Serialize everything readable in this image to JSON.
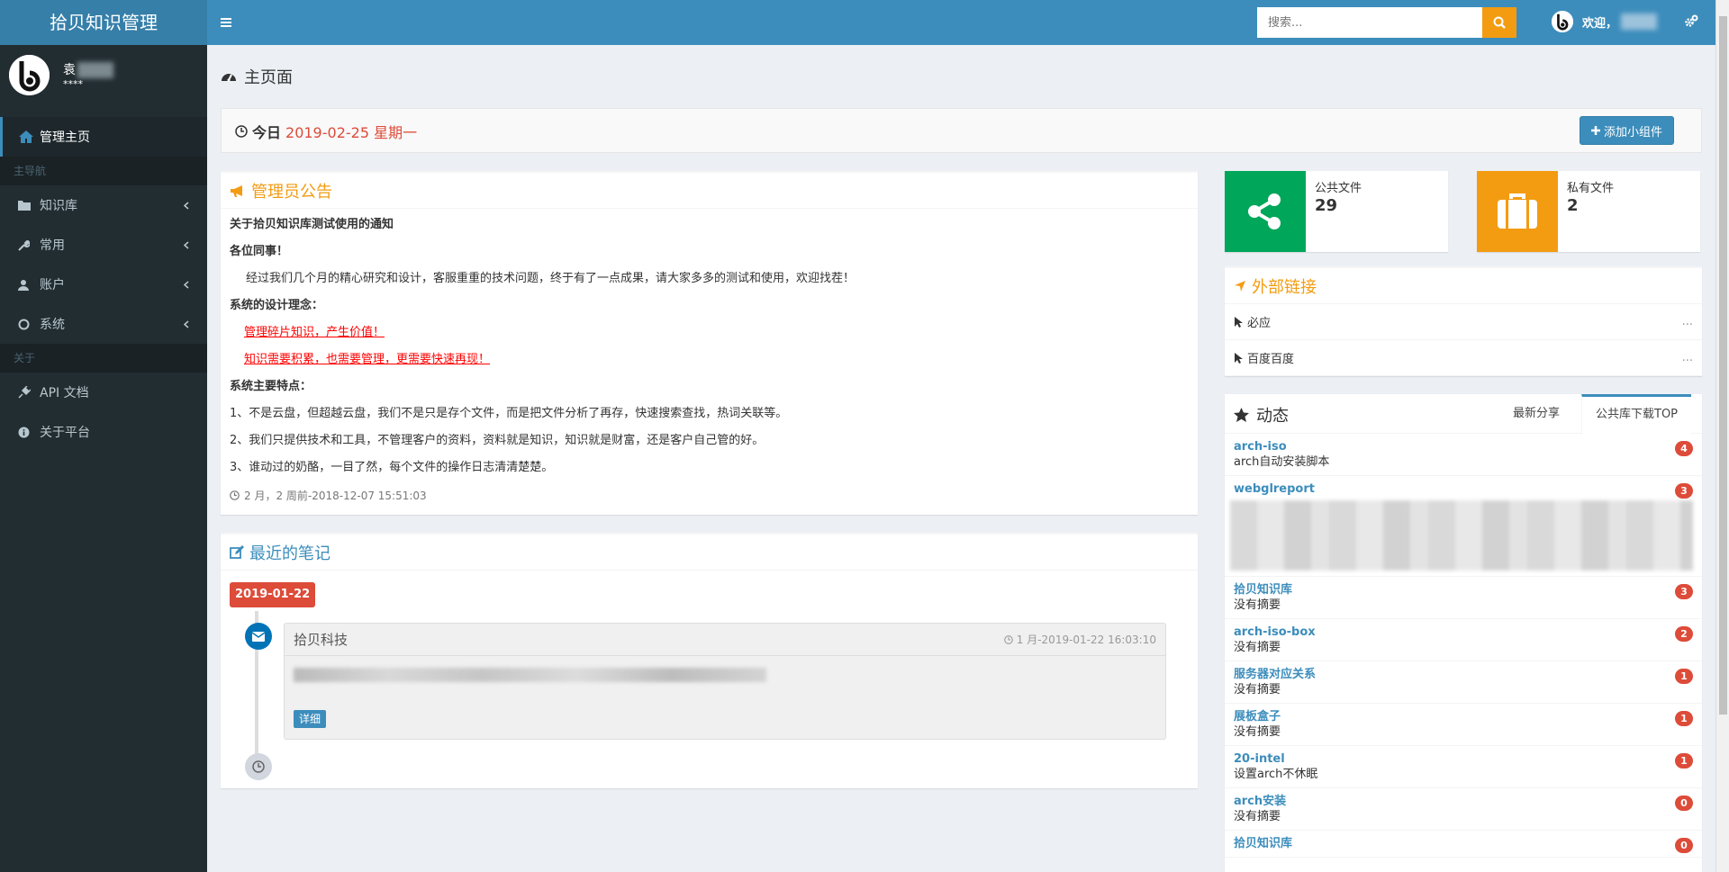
{
  "app": {
    "title": "拾贝知识管理"
  },
  "user": {
    "name": "袁",
    "status": "****",
    "welcome": "欢迎，"
  },
  "search": {
    "placeholder": "搜索..."
  },
  "sidebar": {
    "items": [
      {
        "label": "管理主页",
        "icon": "home-icon"
      },
      {
        "header": "主导航"
      },
      {
        "label": "知识库",
        "icon": "folder-icon"
      },
      {
        "label": "常用",
        "icon": "wrench-icon"
      },
      {
        "label": "账户",
        "icon": "user-icon"
      },
      {
        "label": "系统",
        "icon": "circle-icon"
      },
      {
        "header": "关于"
      },
      {
        "label": "API 文档",
        "icon": "plug-icon"
      },
      {
        "label": "关于平台",
        "icon": "info-icon"
      }
    ]
  },
  "page": {
    "title": "主页面"
  },
  "today": {
    "label": "今日",
    "date": "2019-02-25 星期一",
    "add_button": "添加小组件"
  },
  "notice": {
    "title": "管理员公告",
    "heading": "关于拾贝知识库测试使用的通知",
    "greeting": "各位同事！",
    "intro": "经过我们几个月的精心研究和设计，客服重重的技术问题，终于有了一点成果，请大家多多的测试和使用，欢迎找茬！",
    "concept_title": "系统的设计理念：",
    "concept_1": "管理碎片知识，产生价值！",
    "concept_2": "知识需要积累，也需要管理，更需要快速再现！",
    "features_title": "系统主要特点：",
    "feature_1": "1、不是云盘，但超越云盘，我们不是只是存个文件，而是把文件分析了再存，快速搜索查找，热词关联等。",
    "feature_2": "2、我们只提供技术和工具，不管理客户的资料，资料就是知识，知识就是财富，还是客户自己管的好。",
    "feature_3": "3、谁动过的奶酪，一目了然，每个文件的操作日志清清楚楚。",
    "meta": "2 月，2 周前-2018-12-07 15:51:03"
  },
  "notes": {
    "title": "最近的笔记",
    "date": "2019-01-22",
    "item_title": "拾贝科技",
    "item_time": "1 月-2019-01-22 16:03:10",
    "detail_button": "详细"
  },
  "stats": [
    {
      "label": "公共文件",
      "value": "29",
      "color": "#00a65a",
      "icon": "share-icon"
    },
    {
      "label": "私有文件",
      "value": "2",
      "color": "#f39c12",
      "icon": "briefcase-icon"
    }
  ],
  "links": {
    "title": "外部链接",
    "items": [
      {
        "label": "必应",
        "more": "..."
      },
      {
        "label": "百度百度",
        "more": "..."
      }
    ]
  },
  "activity": {
    "title": "动态",
    "tabs": [
      "最新分享",
      "公共库下载TOP"
    ],
    "items": [
      {
        "name": "arch-iso",
        "desc": "arch自动安装脚本",
        "count": "4"
      },
      {
        "name": "webglreport",
        "desc": "",
        "count": "3"
      },
      {
        "name": "拾贝知识库",
        "desc": "没有摘要",
        "count": "3"
      },
      {
        "name": "arch-iso-box",
        "desc": "没有摘要",
        "count": "2"
      },
      {
        "name": "服务器对应关系",
        "desc": "没有摘要",
        "count": "1"
      },
      {
        "name": "展板盒子",
        "desc": "没有摘要",
        "count": "1"
      },
      {
        "name": "20-intel",
        "desc": "设置arch不休眠",
        "count": "1"
      },
      {
        "name": "arch安装",
        "desc": "没有摘要",
        "count": "0"
      },
      {
        "name": "拾贝知识库",
        "desc": "",
        "count": "0"
      }
    ]
  },
  "colors": {
    "primary": "#3c8dbc",
    "sidebar": "#222d32",
    "danger": "#dd4b39",
    "warning": "#f39c12",
    "success": "#00a65a"
  }
}
